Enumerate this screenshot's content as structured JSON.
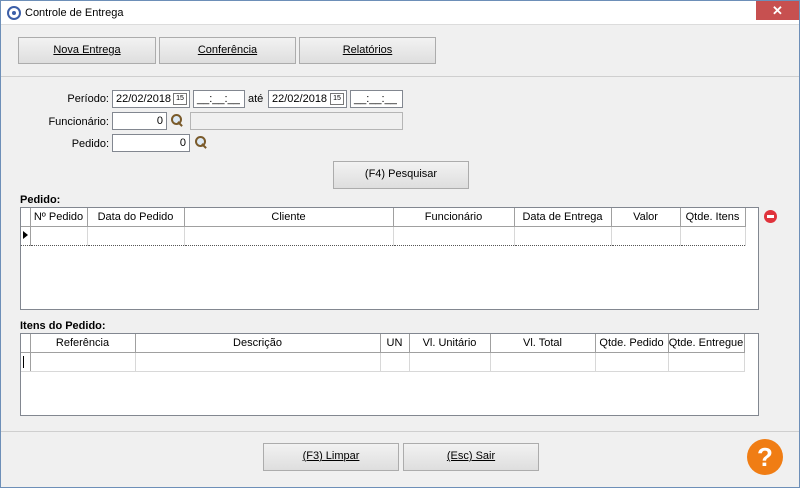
{
  "window": {
    "title": "Controle de Entrega",
    "close_glyph": "✕"
  },
  "toolbar": {
    "nova_entrega": "Nova Entrega",
    "conferencia": "Conferência",
    "relatorios": "Relatórios"
  },
  "filters": {
    "periodo_label": "Período:",
    "periodo_inicio": "22/02/2018",
    "periodo_inicio_hora": "__:__:__",
    "ate_label": "até",
    "periodo_fim": "22/02/2018",
    "periodo_fim_hora": "__:__:__",
    "calendar_glyph": "15",
    "funcionario_label": "Funcionário:",
    "funcionario_codigo": "0",
    "funcionario_nome": "",
    "pedido_label": "Pedido:",
    "pedido_codigo": "0",
    "pesquisar_button": "(F4) Pesquisar"
  },
  "pedidos": {
    "section_label": "Pedido:",
    "columns": [
      "Nº Pedido",
      "Data do Pedido",
      "Cliente",
      "Funcionário",
      "Data de Entrega",
      "Valor",
      "Qtde. Itens"
    ]
  },
  "itens": {
    "section_label": "Itens do Pedido:",
    "columns": [
      "Referência",
      "Descrição",
      "UN",
      "Vl. Unitário",
      "Vl. Total",
      "Qtde. Pedido",
      "Qtde. Entregue"
    ]
  },
  "footer": {
    "limpar_button": "(F3) Limpar",
    "sair_button": "(Esc) Sair",
    "help_glyph": "?"
  },
  "icons": {
    "window": "app-icon",
    "search": "magnifier-icon",
    "remove": "remove-row-icon",
    "help": "help-icon"
  },
  "colors": {
    "help_accent": "#f07d14",
    "remove_accent": "#e0333c",
    "close_button": "#c75050"
  }
}
